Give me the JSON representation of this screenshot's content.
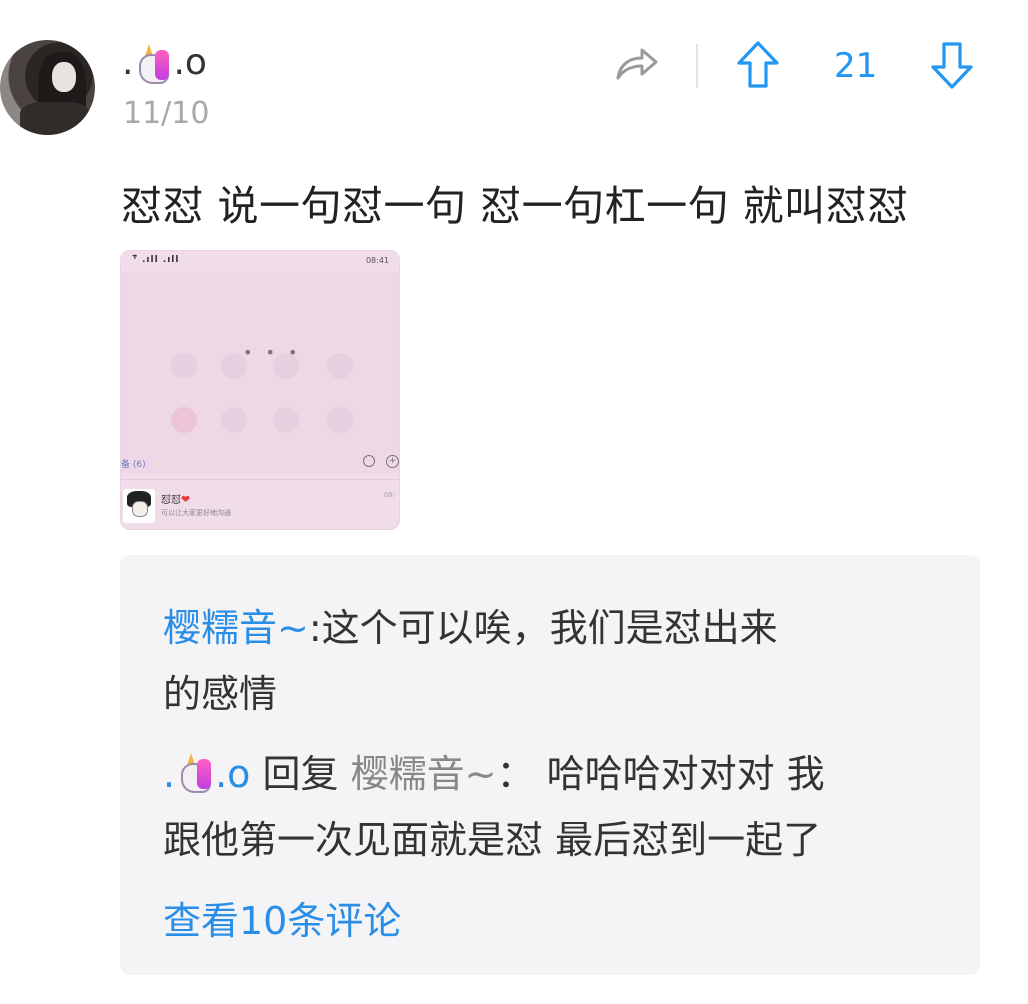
{
  "post": {
    "username_prefix": ".",
    "username_suffix": ".o",
    "username_icon": "unicorn-icon",
    "date": "11/10",
    "votes": "21",
    "text": "怼怼 说一句怼一句 怼一句杠一句 就叫怼怼",
    "icons": {
      "share": "share-arrow-icon",
      "upvote": "upvote-arrow-icon",
      "downvote": "downvote-arrow-icon"
    }
  },
  "thumbnail": {
    "status_left": "ᵀ᷈ .ıll .ıll",
    "status_right": "08:41",
    "dots": "• • •",
    "list_label": "备 (6)",
    "chat_name": "怼怼",
    "chat_sub": "可以让大家更好地沟通",
    "chat_time": "08:"
  },
  "comments": {
    "first_author": "樱糯音~",
    "first_sep": ":",
    "first_text_1": "这个可以唉，我们是怼出来",
    "first_text_2": "的感情",
    "reply_author_prefix": ".",
    "reply_author_suffix": ".o",
    "reply_word": "回复",
    "reply_target": "樱糯音~",
    "reply_sep": "：",
    "reply_text_1": "哈哈哈对对对 我",
    "reply_text_2": "跟他第一次见面就是怼 最后怼到一起了",
    "view_more": "查看10条评论"
  },
  "colors": {
    "accent": "#2a8ee6",
    "vote": "#2196f3",
    "muted": "#a9a9a9",
    "comment_bg": "#f4f4f6"
  }
}
